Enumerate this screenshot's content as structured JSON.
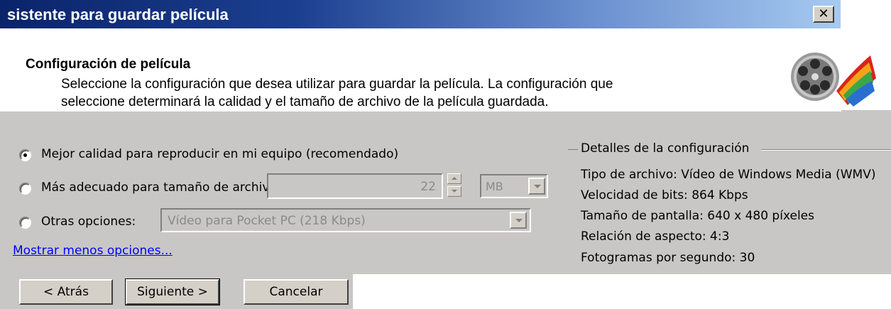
{
  "window": {
    "title": "sistente para guardar película",
    "close_label": "✕"
  },
  "header": {
    "title": "Configuración de película",
    "description_line1": "Seleccione la configuración que desea utilizar para guardar la película. La configuración que",
    "description_line2": "seleccione determinará la calidad y el tamaño de archivo de la película guardada.",
    "icon": "film-reel-icon"
  },
  "options": {
    "best_quality": {
      "label": "Mejor calidad para reproducir en mi equipo (recomendado)",
      "selected": true
    },
    "file_size": {
      "label": "Más adecuado para tamaño de archivo:",
      "selected": false,
      "value": "22",
      "unit": "MB"
    },
    "other": {
      "label": "Otras opciones:",
      "selected": false,
      "value": "Vídeo para Pocket PC (218 Kbps)"
    },
    "toggle_link": "Mostrar menos opciones..."
  },
  "details": {
    "group_label": "Detalles de la configuración",
    "file_type": "Tipo de archivo: Vídeo de Windows Media (WMV)",
    "bitrate": "Velocidad de bits: 864 Kbps",
    "display_size": "Tamaño de pantalla: 640 x 480 píxeles",
    "aspect_ratio": "Relación de aspecto: 4:3",
    "fps": "Fotogramas por segundo: 30"
  },
  "buttons": {
    "back": "< Atrás",
    "next": "Siguiente >",
    "cancel": "Cancelar"
  },
  "colors": {
    "titlebar_start": "#0a246a",
    "titlebar_end": "#a6caf0",
    "dialog_face": "#c9c7c5",
    "link": "#0000ff"
  }
}
